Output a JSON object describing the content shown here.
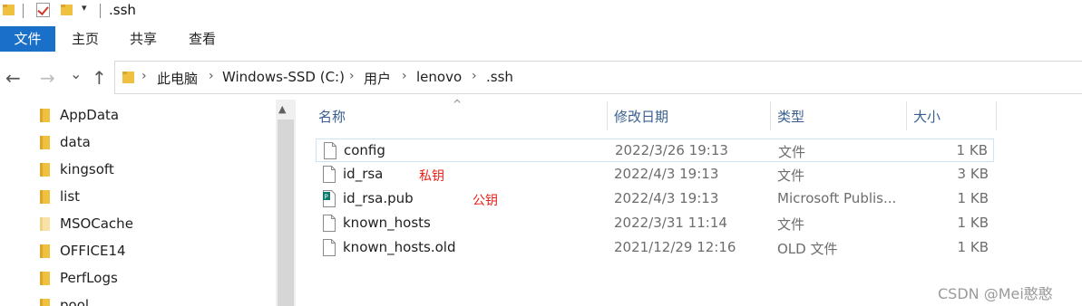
{
  "window": {
    "title": ".ssh",
    "quick_access_dropdown": "▾"
  },
  "ribbon": {
    "tabs": [
      {
        "label": "文件",
        "active": true
      },
      {
        "label": "主页"
      },
      {
        "label": "共享"
      },
      {
        "label": "查看"
      }
    ]
  },
  "navigation": {
    "back": "←",
    "forward": "→",
    "recent": "⌄",
    "up": "↑"
  },
  "address_bar": {
    "chevron": "›",
    "crumbs": [
      "此电脑",
      "Windows-SSD (C:)",
      "用户",
      "lenovo",
      ".ssh"
    ]
  },
  "nav_pane": {
    "items": [
      {
        "label": "AppData",
        "faded": false
      },
      {
        "label": "data",
        "faded": false
      },
      {
        "label": "kingsoft",
        "faded": false
      },
      {
        "label": "list",
        "faded": false
      },
      {
        "label": "MSOCache",
        "faded": true
      },
      {
        "label": "OFFICE14",
        "faded": false
      },
      {
        "label": "PerfLogs",
        "faded": false
      },
      {
        "label": "pool",
        "faded": false
      }
    ],
    "scroll_up": "▲"
  },
  "file_list": {
    "sort_indicator": "^",
    "columns": [
      "名称",
      "修改日期",
      "类型",
      "大小"
    ],
    "rows": [
      {
        "name": "config",
        "modified": "2022/3/26 19:13",
        "type": "文件",
        "size": "1 KB",
        "icon": "blank-file-icon",
        "selected": true
      },
      {
        "name": "id_rsa",
        "modified": "2022/4/3 19:13",
        "type": "文件",
        "size": "3 KB",
        "icon": "blank-file-icon"
      },
      {
        "name": "id_rsa.pub",
        "modified": "2022/4/3 19:13",
        "type": "Microsoft Publis...",
        "size": "1 KB",
        "icon": "publisher-file-icon"
      },
      {
        "name": "known_hosts",
        "modified": "2022/3/31 11:14",
        "type": "文件",
        "size": "1 KB",
        "icon": "blank-file-icon"
      },
      {
        "name": "known_hosts.old",
        "modified": "2021/12/29 12:16",
        "type": "OLD 文件",
        "size": "1 KB",
        "icon": "blank-file-icon"
      }
    ]
  },
  "annotations": {
    "private_key": "私钥",
    "public_key": "公钥"
  },
  "watermark": "CSDN @Mei憨憨",
  "colors": {
    "accent": "#1a6fc9",
    "folder": "#f0c141",
    "annotation": "#e8231a",
    "header_text": "#3a5f8f"
  }
}
